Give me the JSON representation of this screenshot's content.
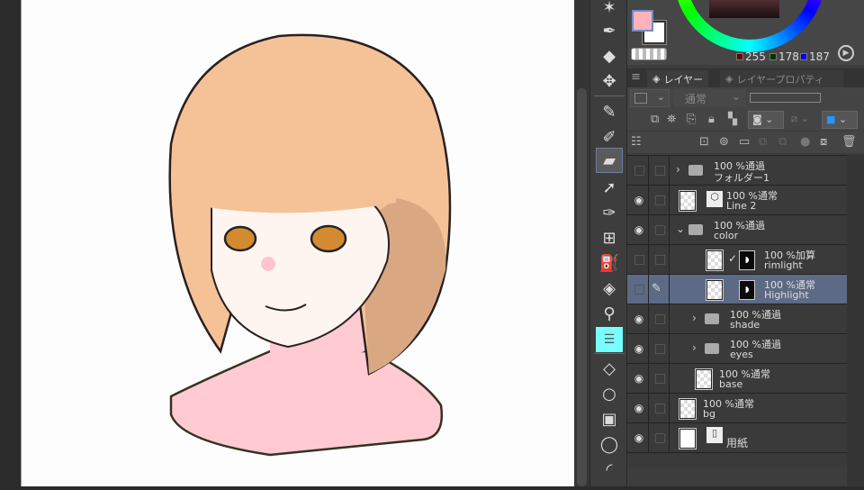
{
  "color": {
    "main": "#ffb2bb",
    "sub": "#ffffff",
    "r": "255",
    "g": "178",
    "b": "187"
  },
  "panel": {
    "tab_layer": "レイヤー",
    "tab_property": "レイヤープロパティ",
    "blend_mode": "通常"
  },
  "layers": [
    {
      "opacity_mode": "100 %通過",
      "name": "フォルダー1",
      "type": "folder",
      "visible": false,
      "expanded": false,
      "indent": 0
    },
    {
      "opacity_mode": "100 %通常",
      "name": "Line 2",
      "type": "vector",
      "visible": true,
      "indent": 0
    },
    {
      "opacity_mode": "100 %通過",
      "name": "color",
      "type": "folder",
      "visible": true,
      "expanded": true,
      "indent": 0
    },
    {
      "opacity_mode": "100 %加算",
      "name": "rimlight",
      "type": "masked",
      "visible": false,
      "indent": 1
    },
    {
      "opacity_mode": "100 %通常",
      "name": "Highlight",
      "type": "masked",
      "visible": false,
      "selected": true,
      "indent": 1
    },
    {
      "opacity_mode": "100 %通過",
      "name": "shade",
      "type": "folder",
      "visible": true,
      "expanded": false,
      "indent": 1
    },
    {
      "opacity_mode": "100 %通過",
      "name": "eyes",
      "type": "folder",
      "visible": true,
      "expanded": false,
      "indent": 1
    },
    {
      "opacity_mode": "100 %通常",
      "name": "base",
      "type": "raster",
      "visible": true,
      "indent": 1
    },
    {
      "opacity_mode": "100 %通常",
      "name": "bg",
      "type": "raster",
      "visible": true,
      "indent": 0
    },
    {
      "opacity_mode": "",
      "name": "用紙",
      "type": "paper",
      "visible": true,
      "indent": 0
    }
  ]
}
